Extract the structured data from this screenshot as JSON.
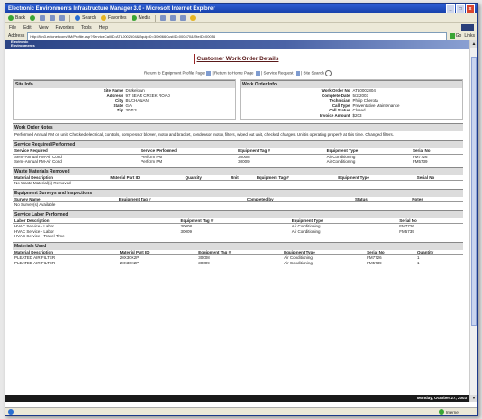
{
  "window": {
    "title": "Electronic Environments Infrastructure Manager 3.0 - Microsoft Internet Explorer",
    "controls": [
      "_",
      "□",
      "x"
    ]
  },
  "toolbar": {
    "back": "Back",
    "search": "Search",
    "favorites": "Favorites",
    "media": "Media"
  },
  "menu": [
    "File",
    "Edit",
    "View",
    "Favorites",
    "Tools",
    "Help"
  ],
  "address": {
    "label": "Address",
    "url": "http://tkn3.eeicnet.com/IIM/Profile.asp?ServiceCallID=ATL0002804&EquipID=300066CustID=000470&SiteID=00056",
    "go": "Go",
    "links": "Links"
  },
  "banner": {
    "line1": "Electronic",
    "line2": "Environments"
  },
  "page": {
    "title": "Customer Work Order Details",
    "nav": {
      "link1": "Return to Equipment Profile Page",
      "link2": "Return to Home Page",
      "link3": "Service Request",
      "link4": "Site Search",
      "sep": "|"
    }
  },
  "site_info": {
    "heading": "Site Info",
    "fields": [
      {
        "k": "Site Name",
        "v": "Drakelown"
      },
      {
        "k": "Address",
        "v": "97 BEAR CREEK ROAD"
      },
      {
        "k": "",
        "v": ""
      },
      {
        "k": "",
        "v": ""
      },
      {
        "k": "City",
        "v": "BUCHANAN"
      },
      {
        "k": "State",
        "v": "GA"
      },
      {
        "k": "Zip",
        "v": "30113"
      }
    ]
  },
  "wo_info": {
    "heading": "Work Order Info",
    "fields": [
      {
        "k": "Work Order No",
        "v": "ATL0002804"
      },
      {
        "k": "Complete Date",
        "v": "5/2/2003"
      },
      {
        "k": "Technician",
        "v": "Philip Cherota"
      },
      {
        "k": "Call Type",
        "v": "Preventative Maintenance"
      },
      {
        "k": "Call Status",
        "v": "Closed"
      },
      {
        "k": "Invoice Amount",
        "v": "$203"
      }
    ]
  },
  "notes": {
    "heading": "Work Order Notes",
    "text": "Performed Annual PM on unit. Checked electrical, controls, compressor blower, motor and bracket, condensor motor, filters, wiped out unit, checked charges. Unit is operating properly at this time. Changed filters."
  },
  "service": {
    "heading": "Service Required/Performed",
    "columns": [
      "Service Required",
      "Service Performed",
      "Equipment Tag #",
      "Equipment Type",
      "Serial No"
    ],
    "rows": [
      [
        "Semi-Annual PM-Air Cond",
        "Perform PM",
        "30008",
        "Air Conditioning",
        "FM7726"
      ],
      [
        "Semi-Annual PM-Air Cond",
        "Perform PM",
        "30009",
        "Air Conditioning",
        "FM5739"
      ]
    ]
  },
  "waste": {
    "heading": "Waste Materials Removed",
    "columns": [
      "Material Description",
      "Material Part ID",
      "Quantity",
      "Unit",
      "Equipment Tag #",
      "Equipment Type",
      "Serial No"
    ],
    "empty": "No Waste Material(s) Removed"
  },
  "surveys": {
    "heading": "Equipment Surveys and Inspections",
    "columns": [
      "Survey Name",
      "Equipment Tag #",
      "Completed by",
      "Status",
      "Notes"
    ],
    "empty": "No Survey(s) Available"
  },
  "labor": {
    "heading": "Service Labor Performed",
    "columns": [
      "Labor Description",
      "Equipment Tag #",
      "Equipment Type",
      "Serial No"
    ],
    "rows": [
      [
        "HVAC Service - Labor",
        "30008",
        "Air Conditioning",
        "FM7726"
      ],
      [
        "HVAC Service - Labor",
        "30009",
        "Air Conditioning",
        "FM5739"
      ],
      [
        "HVAC Service - Travel Time",
        "",
        "",
        ""
      ]
    ]
  },
  "materials": {
    "heading": "Materials Used",
    "columns": [
      "Material Description",
      "Material Part ID",
      "Equipment Tag #",
      "Equipment Type",
      "Serial No",
      "Quantity"
    ],
    "rows": [
      [
        "PLEATED AIR FILTER",
        "20X30X2P",
        "30008",
        "Air Conditioning",
        "FM7726",
        "1"
      ],
      [
        "PLEATED AIR FILTER",
        "20X30X2P",
        "30009",
        "Air Conditioning",
        "FM5739",
        "1"
      ]
    ]
  },
  "datebar": "Monday, October 27, 2003",
  "status": {
    "zone": "Internet"
  }
}
